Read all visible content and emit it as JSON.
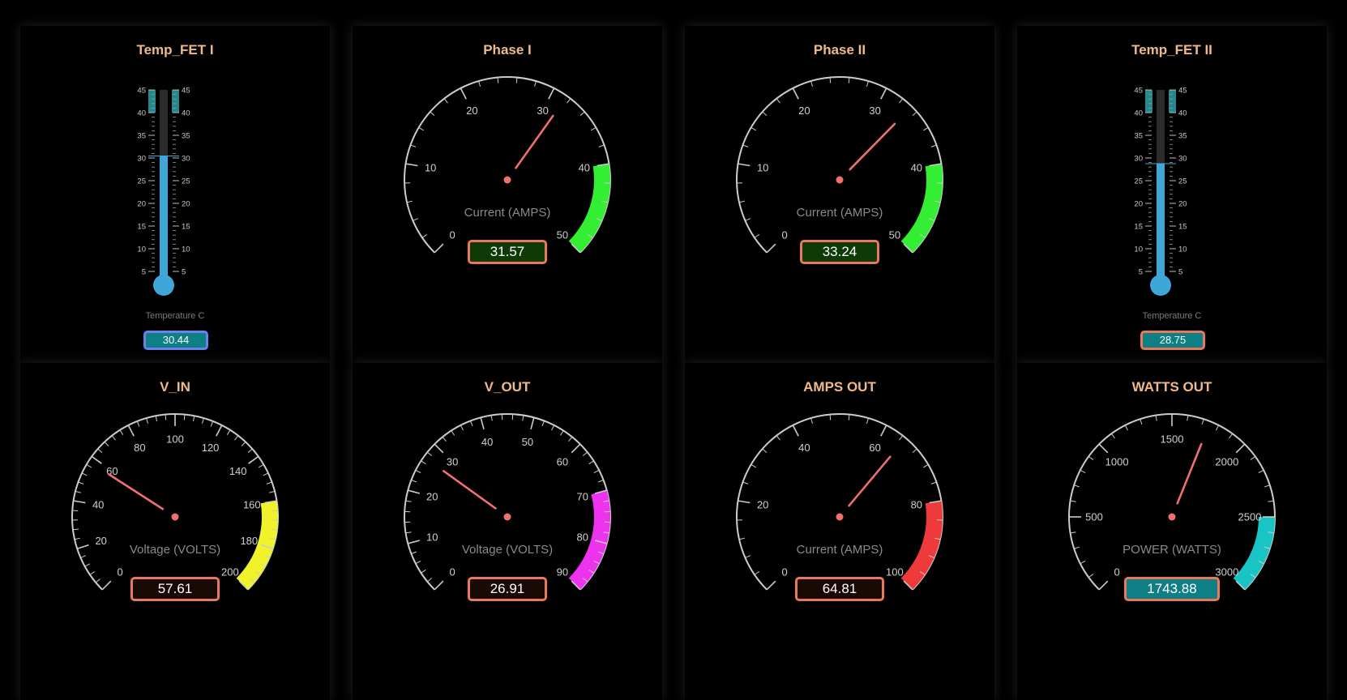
{
  "thermometers": [
    {
      "title": "Temp_FET I",
      "label": "Temperature C",
      "value": 30.44,
      "display": "30.44",
      "min": 5,
      "max": 45,
      "ticks": [
        "5",
        "10",
        "15",
        "20",
        "25",
        "30",
        "35",
        "40",
        "45"
      ],
      "highlight": [
        40,
        45
      ],
      "fill_color": "#3ea7d8",
      "box_border": "#6a82f0",
      "box_bg": "#0f7f86",
      "box_text": "#ffffff"
    },
    {
      "title": "Temp_FET II",
      "label": "Temperature C",
      "value": 28.75,
      "display": "28.75",
      "min": 5,
      "max": 45,
      "ticks": [
        "5",
        "10",
        "15",
        "20",
        "25",
        "30",
        "35",
        "40",
        "45"
      ],
      "highlight": [
        40,
        45
      ],
      "fill_color": "#3ea7d8",
      "box_border": "#e8795a",
      "box_bg": "#0f7f86",
      "box_text": "#ffffff"
    }
  ],
  "gauges": [
    {
      "title": "Phase I",
      "label": "Current (AMPS)",
      "value": 31.57,
      "display": "31.57",
      "min": 0,
      "max": 50,
      "major": [
        "0",
        "10",
        "20",
        "30",
        "40",
        "50"
      ],
      "minor_per_major": 4,
      "zone": [
        40,
        50
      ],
      "zone_color": "#33ee33",
      "box_bg": "#0f3a08",
      "box_text": "#ffffff"
    },
    {
      "title": "Phase II",
      "label": "Current (AMPS)",
      "value": 33.24,
      "display": "33.24",
      "min": 0,
      "max": 50,
      "major": [
        "0",
        "10",
        "20",
        "30",
        "40",
        "50"
      ],
      "minor_per_major": 4,
      "zone": [
        40,
        50
      ],
      "zone_color": "#33ee33",
      "box_bg": "#0f3a08",
      "box_text": "#ffffff"
    },
    {
      "title": "V_IN",
      "label": "Voltage (VOLTS)",
      "value": 57.61,
      "display": "57.61",
      "min": 0,
      "max": 200,
      "major": [
        "0",
        "20",
        "40",
        "60",
        "80",
        "100",
        "120",
        "140",
        "160",
        "180",
        "200"
      ],
      "minor_per_major": 4,
      "zone": [
        160,
        200
      ],
      "zone_color": "#f2f22a",
      "box_bg": "#1a0a05",
      "box_text": "#ffffff"
    },
    {
      "title": "V_OUT",
      "label": "Voltage (VOLTS)",
      "value": 26.91,
      "display": "26.91",
      "min": 0,
      "max": 90,
      "major": [
        "0",
        "10",
        "20",
        "30",
        "40",
        "50",
        "60",
        "70",
        "80",
        "90"
      ],
      "minor_per_major": 4,
      "zone": [
        70,
        90
      ],
      "zone_color": "#ee33ee",
      "box_bg": "#1a0a05",
      "box_text": "#ffffff"
    },
    {
      "title": "AMPS OUT",
      "label": "Current (AMPS)",
      "value": 64.81,
      "display": "64.81",
      "min": 0,
      "max": 100,
      "major": [
        "0",
        "20",
        "40",
        "60",
        "80",
        "100"
      ],
      "minor_per_major": 4,
      "zone": [
        80,
        100
      ],
      "zone_color": "#ee3a3a",
      "box_bg": "#1a0a05",
      "box_text": "#ffffff"
    },
    {
      "title": "WATTS OUT",
      "label": "POWER (WATTS)",
      "value": 1743.88,
      "display": "1743.88",
      "min": 0,
      "max": 3000,
      "major": [
        "0",
        "500",
        "1000",
        "1500",
        "2000",
        "2500",
        "3000"
      ],
      "minor_per_major": 4,
      "zone": [
        2500,
        3000
      ],
      "zone_color": "#18c4c4",
      "box_bg": "#0f7f86",
      "box_text": "#ffffff"
    }
  ],
  "colors": {
    "title": "#f0b98a",
    "needle": "#f07070",
    "box_border": "#e8795a",
    "dial": "#cccccc"
  }
}
